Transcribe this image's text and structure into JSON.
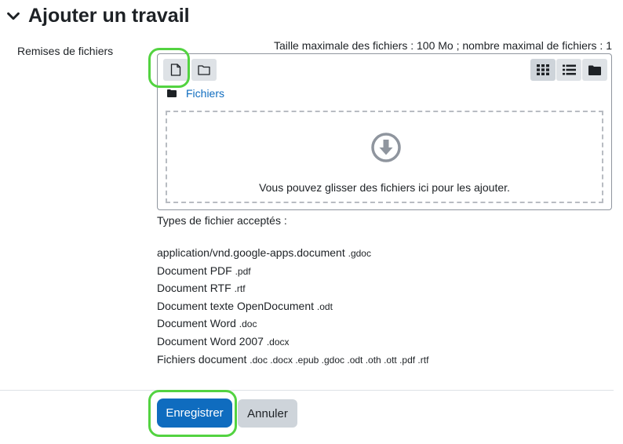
{
  "section": {
    "title": "Ajouter un travail",
    "icon": "chevron-down-icon"
  },
  "field": {
    "label": "Remises de fichiers",
    "limits": "Taille maximale des fichiers : 100 Mo ; nombre maximal de fichiers : 1"
  },
  "filepicker": {
    "toolbar": {
      "left": [
        {
          "icon": "add-file-icon",
          "highlighted": true
        },
        {
          "icon": "create-folder-icon"
        }
      ],
      "right": [
        {
          "icon": "grid-view-icon",
          "active": true
        },
        {
          "icon": "list-view-icon"
        },
        {
          "icon": "tree-view-icon"
        }
      ]
    },
    "breadcrumb": "Fichiers",
    "dropzone_text": "Vous pouvez glisser des fichiers ici pour les ajouter."
  },
  "accepted_types": {
    "heading": "Types de fichier acceptés :",
    "items": [
      {
        "name": "application/vnd.google-apps.document",
        "ext": ".gdoc"
      },
      {
        "name": "Document PDF",
        "ext": ".pdf"
      },
      {
        "name": "Document RTF",
        "ext": ".rtf"
      },
      {
        "name": "Document texte OpenDocument",
        "ext": ".odt"
      },
      {
        "name": "Document Word",
        "ext": ".doc"
      },
      {
        "name": "Document Word 2007",
        "ext": ".docx"
      },
      {
        "name": "Fichiers document",
        "ext": ".doc .docx .epub .gdoc .odt .oth .ott .pdf .rtf"
      }
    ]
  },
  "actions": {
    "save_label": "Enregistrer",
    "save_highlighted": true,
    "cancel_label": "Annuler"
  },
  "colors": {
    "primary": "#0f6cbf",
    "highlight": "#53d341",
    "text": "#1d2125"
  }
}
